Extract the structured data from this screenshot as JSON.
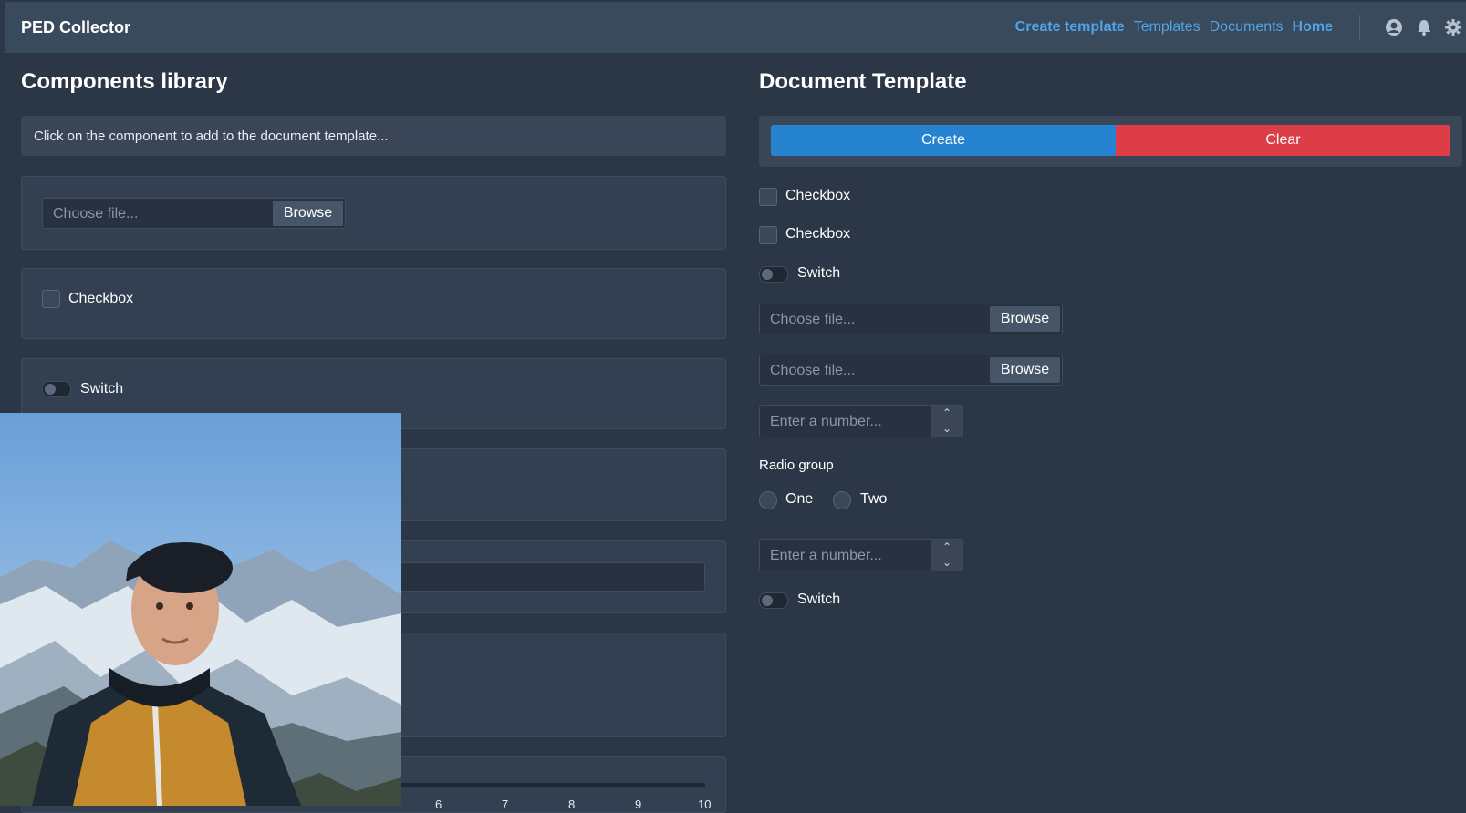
{
  "navbar": {
    "brand": "PED Collector",
    "links": [
      "Create template",
      "Templates",
      "Documents",
      "Home"
    ],
    "icons": [
      "user-icon",
      "bell-icon",
      "gear-icon"
    ]
  },
  "library": {
    "title": "Components library",
    "hint": "Click on the component to add to the document template...",
    "file": {
      "placeholder": "Choose file...",
      "browse": "Browse"
    },
    "checkbox_label": "Checkbox",
    "switch_label": "Switch",
    "slider_ticks": [
      "6",
      "7",
      "8",
      "9",
      "10"
    ]
  },
  "template": {
    "title": "Document Template",
    "create_label": "Create",
    "clear_label": "Clear",
    "checkbox_1": "Checkbox",
    "checkbox_2": "Checkbox",
    "switch_1": "Switch",
    "file_1": {
      "placeholder": "Choose file...",
      "browse": "Browse"
    },
    "file_2": {
      "placeholder": "Choose file...",
      "browse": "Browse"
    },
    "number_1": {
      "placeholder": "Enter a number..."
    },
    "radio_group_label": "Radio group",
    "radio_options": [
      "One",
      "Two"
    ],
    "number_2": {
      "placeholder": "Enter a number..."
    },
    "switch_2": "Switch"
  },
  "colors": {
    "background": "#2b3646",
    "navbar": "#3a4a5d",
    "link": "#4fa3e6",
    "create": "#2683cf",
    "clear": "#dc3d47"
  }
}
